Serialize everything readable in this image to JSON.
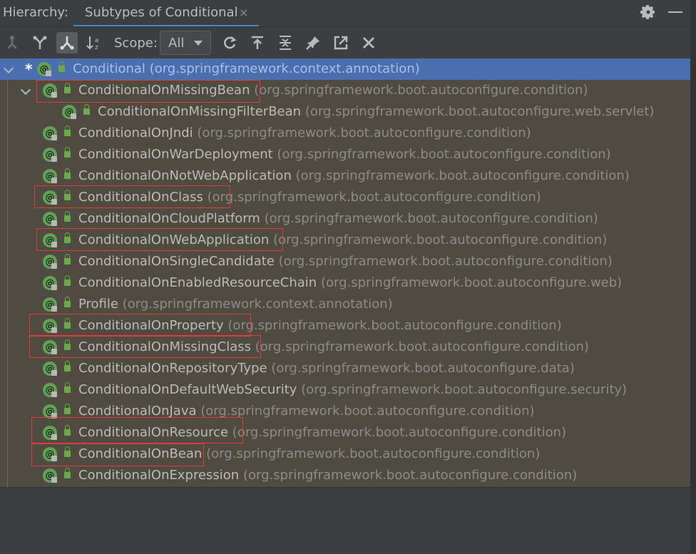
{
  "header": {
    "label": "Hierarchy:",
    "tab_title": "Subtypes of Conditional",
    "tab_close": "×",
    "icons": [
      "gear-icon",
      "minimize-icon"
    ]
  },
  "toolbar": {
    "buttons": [
      "type-hierarchy-icon",
      "supertypes-hierarchy-icon",
      "subtypes-hierarchy-icon",
      "sort-alphabetically-icon",
      "refresh-icon",
      "export-icon",
      "expand-all-icon",
      "pin-icon",
      "open-in-window-icon",
      "close-icon"
    ],
    "scope_label": "Scope:",
    "scope_value": "All"
  },
  "tree": {
    "root": {
      "name": "Conditional",
      "pkg": "(org.springframework.context.annotation)",
      "marker": "*"
    },
    "items": [
      {
        "name": "ConditionalOnMissingBean",
        "pkg": "(org.springframework.boot.autoconfigure.condition)"
      },
      {
        "name": "ConditionalOnMissingFilterBean",
        "pkg": "(org.springframework.boot.autoconfigure.web.servlet)"
      },
      {
        "name": "ConditionalOnJndi",
        "pkg": "(org.springframework.boot.autoconfigure.condition)"
      },
      {
        "name": "ConditionalOnWarDeployment",
        "pkg": "(org.springframework.boot.autoconfigure.condition)"
      },
      {
        "name": "ConditionalOnNotWebApplication",
        "pkg": "(org.springframework.boot.autoconfigure.condition)"
      },
      {
        "name": "ConditionalOnClass",
        "pkg": "(org.springframework.boot.autoconfigure.condition)"
      },
      {
        "name": "ConditionalOnCloudPlatform",
        "pkg": "(org.springframework.boot.autoconfigure.condition)"
      },
      {
        "name": "ConditionalOnWebApplication",
        "pkg": "(org.springframework.boot.autoconfigure.condition)"
      },
      {
        "name": "ConditionalOnSingleCandidate",
        "pkg": "(org.springframework.boot.autoconfigure.condition)"
      },
      {
        "name": "ConditionalOnEnabledResourceChain",
        "pkg": "(org.springframework.boot.autoconfigure.web)"
      },
      {
        "name": "Profile",
        "pkg": "(org.springframework.context.annotation)"
      },
      {
        "name": "ConditionalOnProperty",
        "pkg": "(org.springframework.boot.autoconfigure.condition)"
      },
      {
        "name": "ConditionalOnMissingClass",
        "pkg": "(org.springframework.boot.autoconfigure.condition)"
      },
      {
        "name": "ConditionalOnRepositoryType",
        "pkg": "(org.springframework.boot.autoconfigure.data)"
      },
      {
        "name": "ConditionalOnDefaultWebSecurity",
        "pkg": "(org.springframework.boot.autoconfigure.security)"
      },
      {
        "name": "ConditionalOnJava",
        "pkg": "(org.springframework.boot.autoconfigure.condition)"
      },
      {
        "name": "ConditionalOnResource",
        "pkg": "(org.springframework.boot.autoconfigure.condition)"
      },
      {
        "name": "ConditionalOnBean",
        "pkg": "(org.springframework.boot.autoconfigure.condition)"
      },
      {
        "name": "ConditionalOnExpression",
        "pkg": "(org.springframework.boot.autoconfigure.condition)"
      }
    ]
  },
  "colors": {
    "selection": "#4b6eaf",
    "tree_bg": "#4f4b41",
    "highlight_box": "#e23b3b",
    "annotation_icon": "#62a05b"
  }
}
